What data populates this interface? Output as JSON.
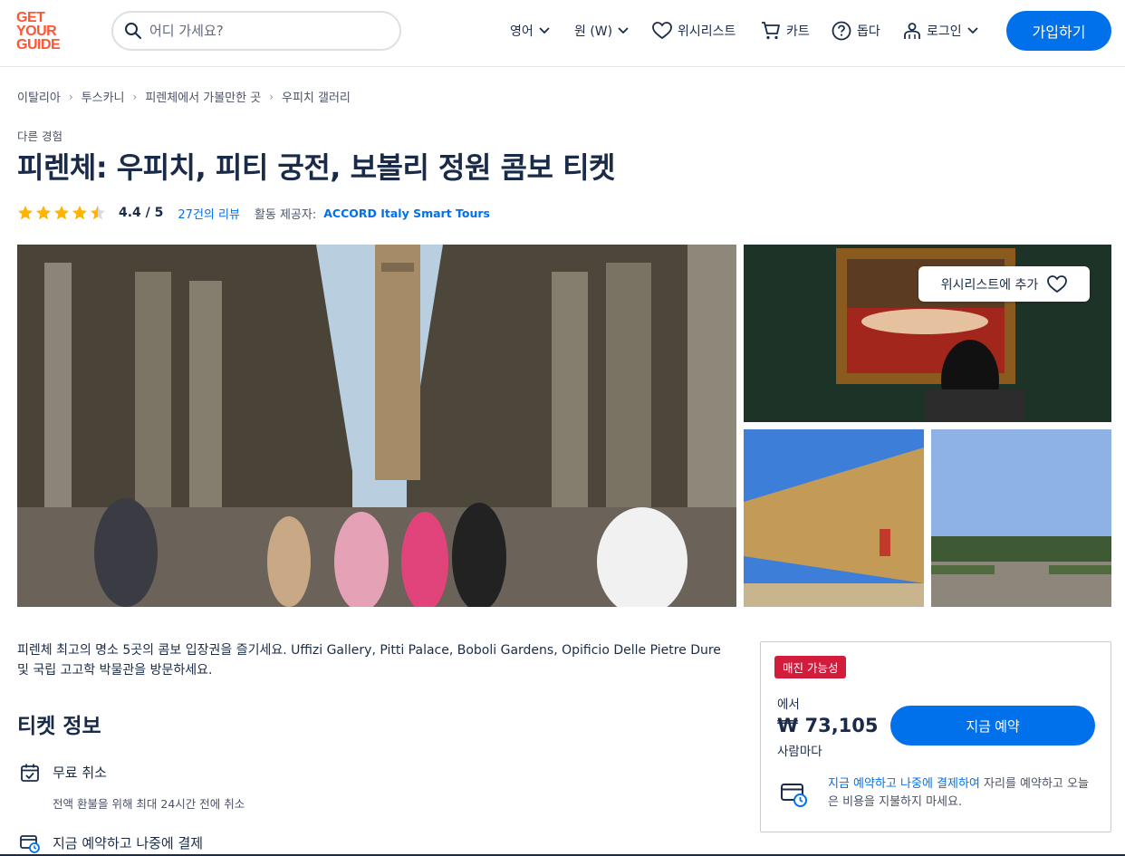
{
  "header": {
    "logo_lines": [
      "GET",
      "YOUR",
      "GUIDE"
    ],
    "search_placeholder": "어디 가세요?",
    "language": "영어",
    "currency": "원 (W)",
    "wishlist": "위시리스트",
    "cart": "카트",
    "help": "돕다",
    "login": "로그인",
    "signup": "가입하기"
  },
  "breadcrumb": [
    "이탈리아",
    "투스카니",
    "피렌체에서 가볼만한 곳",
    "우피치 갤러리"
  ],
  "breadcrumb_sep": "›",
  "product": {
    "category": "다른 경험",
    "title": "피렌체: 우피치, 피티 궁전, 보볼리 정원 콤보 티켓",
    "rating": 4.4,
    "rating_text": "4.4 / 5",
    "reviews": "27건의 리뷰",
    "provider_label": "활동 제공자:",
    "provider": "ACCORD Italy Smart Tours"
  },
  "gallery": {
    "wishlist_button": "위시리스트에 추가"
  },
  "description": "피렌체 최고의 명소 5곳의 콤보 입장권을 즐기세요. Uffizi Gallery, Pitti Palace, Boboli Gardens, Opificio Delle Pietre Dure 및 국립 고고학 박물관을 방문하세요.",
  "ticket_info": {
    "title": "티켓 정보",
    "features": [
      {
        "title": "무료 취소",
        "subtitle": "전액 환불을 위해 최대 24시간 전에 취소"
      },
      {
        "title": "지금 예약하고 나중에 결제",
        "subtitle": ""
      }
    ]
  },
  "booking": {
    "badge": "매진 가능성",
    "from": "에서",
    "price": "₩ 73,105",
    "per": "사람마다",
    "button": "지금 예약",
    "note_link": "지금 예약하고 나중에 결제하여",
    "note_rest": " 자리를 예약하고 오늘은 비용을 지불하지 마세요."
  },
  "colors": {
    "brand": "#ff5533",
    "primary": "#0071eb",
    "badge": "#d21c3c",
    "text": "#1a2b49",
    "star": "#ffb400"
  }
}
